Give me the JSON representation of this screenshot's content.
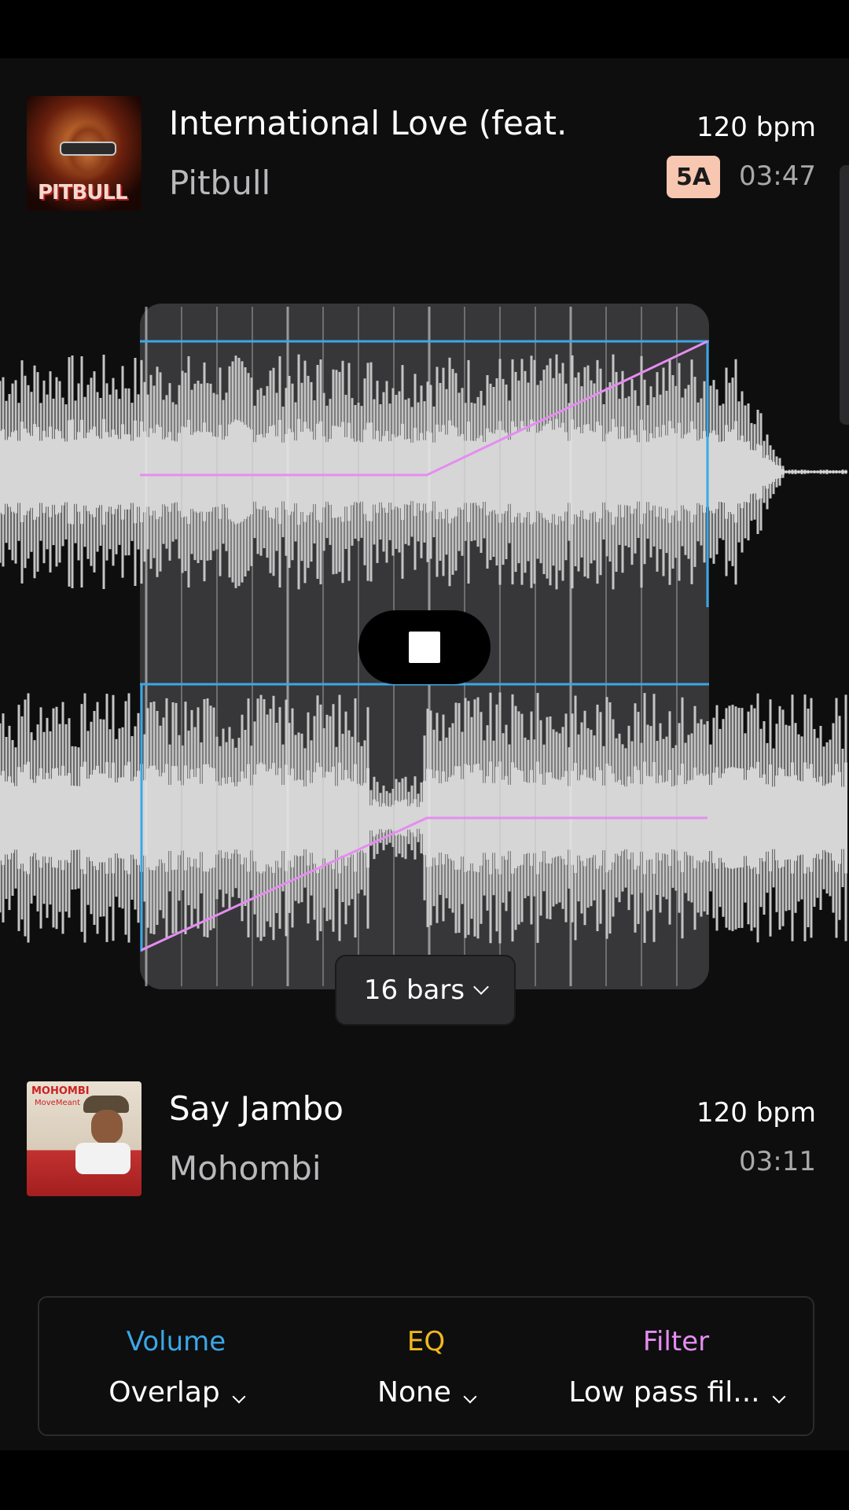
{
  "colors": {
    "volume": "#3ba7e6",
    "eq": "#f1b81e",
    "filter": "#e58df0",
    "key_badge": "#f7c7b2",
    "waveform": "#c4c4c4"
  },
  "track_a": {
    "title": "International Love (feat.",
    "artist": "Pitbull",
    "bpm": "120 bpm",
    "key": "5A",
    "duration": "03:47",
    "cover_text": "PITBULL"
  },
  "track_b": {
    "title": "Say Jambo",
    "artist": "Mohombi",
    "bpm": "120 bpm",
    "duration": "03:11",
    "cover_text": "MOHOMBI",
    "cover_subtext": "MoveMeant"
  },
  "transition": {
    "length_label": "16 bars",
    "stop_icon": "stop-icon"
  },
  "controls": {
    "volume_label": "Volume",
    "volume_value": "Overlap",
    "eq_label": "EQ",
    "eq_value": "None",
    "filter_label": "Filter",
    "filter_value": "Low pass fil..."
  }
}
